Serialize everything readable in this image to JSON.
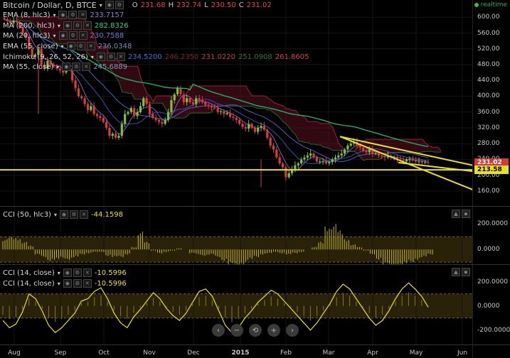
{
  "header": {
    "symbol": "Bitcoin / Dollar, D, BTCE",
    "ohlc": {
      "o_label": "O",
      "o": "231.68",
      "h_label": "H",
      "h": "232.74",
      "l_label": "L",
      "l": "230.50",
      "c_label": "C",
      "c": "231.02"
    },
    "realtime": "realtime"
  },
  "indicators": [
    {
      "name": "EMA (8, hlc3)",
      "value": "233.7157",
      "color": "#8f7bd1"
    },
    {
      "name": "MA (200, hlc3)",
      "value": "282.8326",
      "color": "#31d18a"
    },
    {
      "name": "MA (20, hlc3)",
      "value": "230.7588",
      "color": "#6d7fd6"
    },
    {
      "name": "EMA (55, close)",
      "value": "236.0348",
      "color": "#7b8fb8"
    },
    {
      "name": "Ichimoku (9, 26, 52, 26)",
      "values": [
        "234.5200",
        "246.2350",
        "231.0220",
        "251.0908",
        "261.8605"
      ],
      "colors": [
        "#3b78d6",
        "#8b2030",
        "#c44030",
        "#2a7a3a",
        "#d24046"
      ]
    },
    {
      "name": "MA (55, close)",
      "value": "245.6889",
      "color": "#7a9ab8"
    }
  ],
  "price_axis": {
    "ticks": [
      "600.00",
      "560.00",
      "520.00",
      "480.00",
      "440.00",
      "400.00",
      "360.00",
      "320.00",
      "280.00",
      "240.00",
      "200.00",
      "160.00"
    ],
    "current": "231.02",
    "line_label": "213.58"
  },
  "x_axis": {
    "ticks": [
      "Aug",
      "Sep",
      "Oct",
      "Nov",
      "Dec",
      "2015",
      "Feb",
      "Mar",
      "Apr",
      "May",
      "Jun"
    ]
  },
  "cci1": {
    "name": "CCI (50, hlc3)",
    "value": "-44.1598",
    "ticks": [
      "200.0000",
      "0.0000"
    ]
  },
  "cci2": {
    "rows": [
      {
        "name": "CCI (14, close)",
        "value": "-10.5996"
      },
      {
        "name": "CCI (14, close)",
        "value": "-10.5996"
      }
    ],
    "ticks": [
      "200.0000",
      "0.0000",
      "-200.0000"
    ]
  },
  "nav": {
    "back": "‹",
    "zoom_out": "−",
    "reset": "⟲",
    "zoom_in": "+",
    "forward": "›"
  },
  "chart_data": {
    "type": "candlestick",
    "ylim": [
      140,
      615
    ],
    "close_series": [
      595,
      590,
      585,
      592,
      588,
      575,
      560,
      550,
      520,
      500,
      505,
      520,
      480,
      470,
      490,
      480,
      475,
      470,
      465,
      460,
      470,
      470,
      440,
      420,
      400,
      395,
      380,
      365,
      375,
      355,
      350,
      345,
      335,
      320,
      300,
      305,
      295,
      300,
      330,
      355,
      360,
      370,
      350,
      360,
      375,
      395,
      380,
      355,
      345,
      340,
      335,
      330,
      340,
      360,
      390,
      405,
      420,
      405,
      385,
      395,
      385,
      380,
      395,
      390,
      385,
      378,
      375,
      372,
      370,
      360,
      362,
      355,
      358,
      348,
      345,
      340,
      330,
      322,
      318,
      330,
      320,
      310,
      320,
      325,
      315,
      295,
      275,
      265,
      245,
      230,
      220,
      195,
      205,
      215,
      225,
      230,
      240,
      245,
      250,
      255,
      245,
      235,
      235,
      235,
      230,
      233,
      240,
      245,
      250,
      255,
      265,
      275,
      280,
      285,
      275,
      270,
      262,
      258,
      265,
      255,
      255,
      250,
      248,
      245,
      250,
      245,
      245,
      240,
      238,
      235,
      240,
      242,
      238,
      235,
      235,
      232,
      233,
      231
    ],
    "support_line": 213.58,
    "cci50": [
      80,
      100,
      90,
      60,
      30,
      -40,
      -60,
      -90,
      -80,
      -70,
      -80,
      -60,
      -40,
      -30,
      -20,
      -20,
      -50,
      -60,
      -60,
      -40,
      20,
      140,
      60,
      -10,
      -30,
      -20,
      -10,
      10,
      0,
      -30,
      -40,
      -50,
      -40,
      -60,
      -90,
      -120,
      -140,
      -120,
      -80,
      -60,
      -40,
      -30,
      -20,
      -30,
      -40,
      -30,
      -20,
      0,
      20,
      60,
      180,
      200,
      150,
      80,
      40,
      20,
      -10,
      -40,
      -80,
      -120,
      -140,
      -140,
      -120,
      -100,
      -80,
      -60,
      -40
    ],
    "cci14": [
      -120,
      -180,
      -150,
      -50,
      100,
      60,
      -40,
      -160,
      -220,
      -180,
      -120,
      -60,
      40,
      60,
      120,
      150,
      60,
      -60,
      -140,
      -180,
      -90,
      -30,
      40,
      110,
      60,
      -20,
      -80,
      -120,
      -60,
      30,
      120,
      140,
      80,
      -40,
      -160,
      -220,
      -180,
      -100,
      -40,
      30,
      80,
      130,
      100,
      40,
      -20,
      -80,
      -140,
      -200,
      -140,
      -60,
      20,
      120,
      180,
      140,
      60,
      -20,
      -100,
      -160,
      -120,
      -40,
      60,
      140,
      190,
      140,
      80,
      -10
    ]
  }
}
